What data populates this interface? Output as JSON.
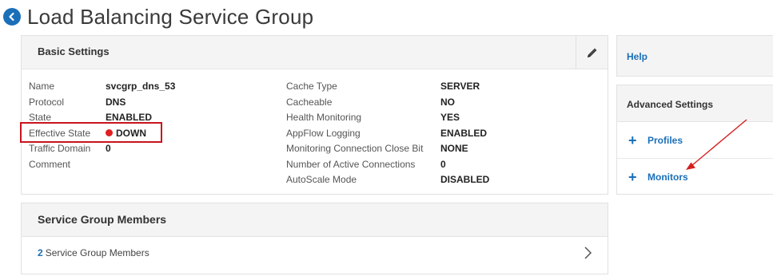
{
  "page": {
    "title": "Load Balancing Service Group"
  },
  "basic_settings": {
    "title": "Basic Settings",
    "left_fields": [
      {
        "label": "Name",
        "value": "svcgrp_dns_53"
      },
      {
        "label": "Protocol",
        "value": "DNS"
      },
      {
        "label": "State",
        "value": "ENABLED"
      },
      {
        "label": "Effective State",
        "value": "DOWN"
      },
      {
        "label": "Traffic Domain",
        "value": "0"
      },
      {
        "label": "Comment",
        "value": ""
      }
    ],
    "right_fields": [
      {
        "label": "Cache Type",
        "value": "SERVER"
      },
      {
        "label": "Cacheable",
        "value": "NO"
      },
      {
        "label": "Health Monitoring",
        "value": "YES"
      },
      {
        "label": "AppFlow Logging",
        "value": "ENABLED"
      },
      {
        "label": "Monitoring Connection Close Bit",
        "value": "NONE"
      },
      {
        "label": "Number of Active Connections",
        "value": "0"
      },
      {
        "label": "AutoScale Mode",
        "value": "DISABLED"
      }
    ]
  },
  "service_group_members": {
    "title": "Service Group Members",
    "count": "2",
    "link_label": "Service Group Members"
  },
  "sidebar": {
    "help_label": "Help",
    "advanced_settings": {
      "title": "Advanced Settings",
      "items": [
        {
          "label": "Profiles"
        },
        {
          "label": "Monitors"
        }
      ]
    }
  },
  "colors": {
    "accent": "#1a6fb8",
    "status_down": "#e02020",
    "highlight": "#c8141e",
    "panel_header": "#f4f4f4"
  },
  "icons": {
    "back": "circle-arrow-left-icon",
    "edit": "pencil-icon",
    "chevron": "chevron-right-icon",
    "add": "plus-icon",
    "status": "red-dot-icon",
    "annotation": "red-arrow-annotation"
  }
}
